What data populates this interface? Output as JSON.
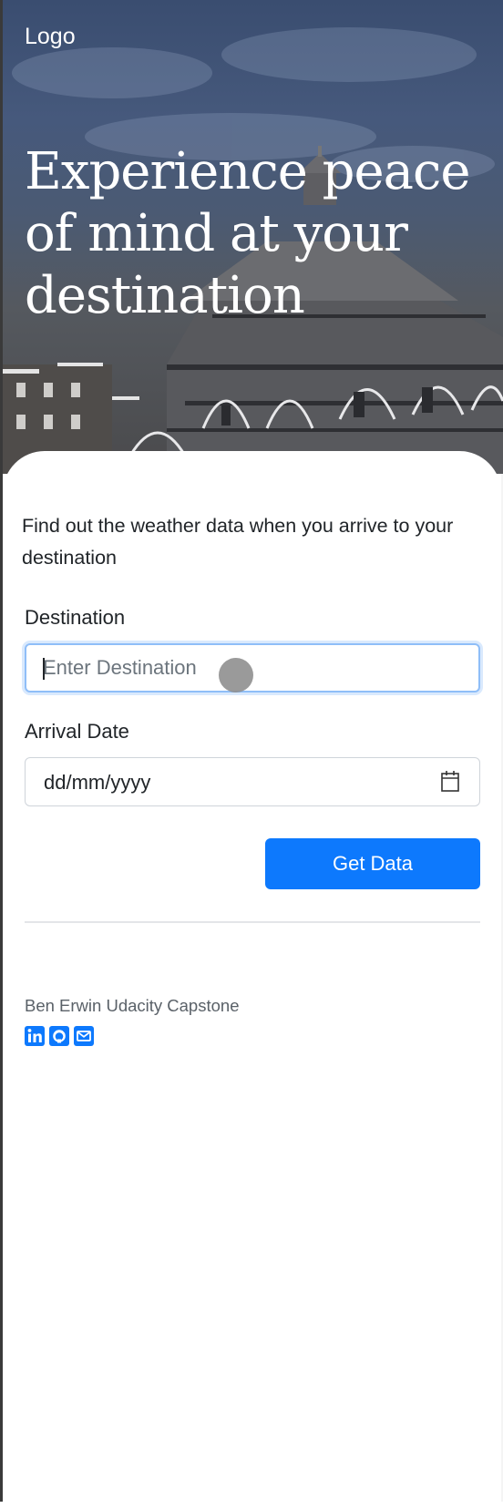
{
  "header": {
    "logo": "Logo"
  },
  "hero": {
    "title": "Experience peace of mind at your destination"
  },
  "form": {
    "intro": "Find out the weather data when you arrive to your destination",
    "destination": {
      "label": "Destination",
      "placeholder": "Enter Destination",
      "value": ""
    },
    "arrival": {
      "label": "Arrival Date",
      "placeholder": "dd/mm/yyyy"
    },
    "submit_label": "Get Data"
  },
  "footer": {
    "credit": "Ben Erwin Udacity Capstone",
    "social": [
      "linkedin-icon",
      "github-icon",
      "email-icon"
    ]
  },
  "colors": {
    "accent": "#0d79fd",
    "focus_border": "#8fbef8",
    "text": "#212529",
    "muted": "#6c757d"
  }
}
